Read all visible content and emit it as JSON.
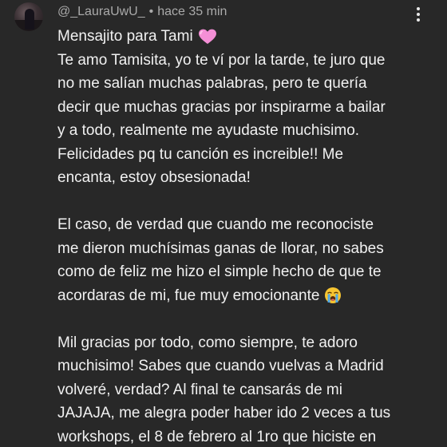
{
  "comment": {
    "username": "@_LauraUwU_",
    "separator": "•",
    "timestamp": "hace 35 min",
    "avatar_icon": "avatar-photo",
    "more_icon": "more-vert-icon",
    "lines": [
      "Mensajito para Tami",
      "Te amo Tamisita, yo te ví por la tarde, te juro que",
      "no me salían muchas palabras, pero te quería",
      "decir que muchas gracias por inspirarme a bailar",
      "y a todo, realmente me ayudaste muchisimo.",
      "Felicidades pq tu canción es increible!! Me",
      "encanta, estoy obsesionada!",
      "",
      "El caso, de verdad que cuando me reconociste",
      "me dieron muchísimas ganas de llorar, no sabes",
      "como de feliz me hizo el simple hecho de que te",
      "acordaras de mi, fue muy emocionante",
      "",
      "Mil gracias por todo, como siempre, te adoro",
      "muchisimo! Sabes que cuando vuelvas a Madrid",
      "volveré, verdad? Al final te cansarás de mi",
      "JAJAJA, me alegra poder haber ido 2 veces a tus",
      "workshops, el 8 de febrero al 1ro que hiciste en"
    ],
    "emoji": {
      "heart": "pink-heart-emoji",
      "crying": "loudly-crying-face-emoji"
    },
    "colors": {
      "background": "#282828",
      "text": "#f1f1f1",
      "meta": "#aaaaaa",
      "heart": "#f48fd6",
      "cry_face": "#f7c531",
      "tears": "#4fa8e8"
    }
  }
}
